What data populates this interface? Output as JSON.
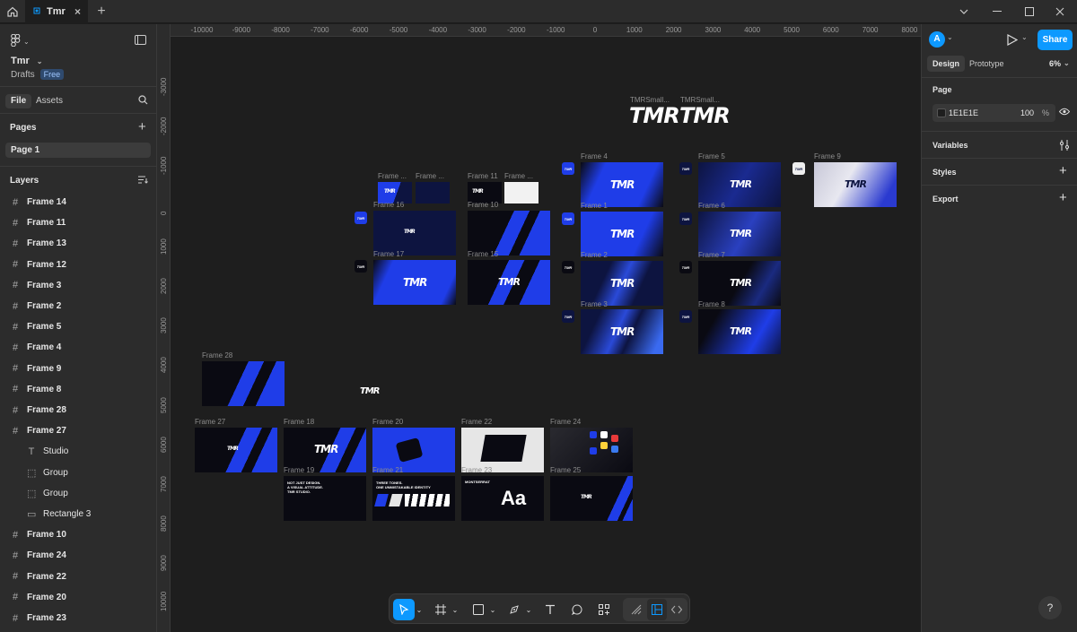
{
  "tabs": {
    "file_tab_label": "Tmr"
  },
  "left_panel": {
    "file_name": "Tmr",
    "location": "Drafts",
    "plan_badge": "Free",
    "file_tab": "File",
    "assets_tab": "Assets",
    "pages_title": "Pages",
    "pages": [
      "Page 1"
    ],
    "layers_title": "Layers",
    "layers": [
      {
        "label": "Frame 14",
        "type": "frame"
      },
      {
        "label": "Frame 11",
        "type": "frame"
      },
      {
        "label": "Frame 13",
        "type": "frame"
      },
      {
        "label": "Frame 12",
        "type": "frame"
      },
      {
        "label": "Frame 3",
        "type": "frame"
      },
      {
        "label": "Frame 2",
        "type": "frame"
      },
      {
        "label": "Frame 5",
        "type": "frame"
      },
      {
        "label": "Frame 4",
        "type": "frame"
      },
      {
        "label": "Frame 9",
        "type": "frame"
      },
      {
        "label": "Frame 8",
        "type": "frame"
      },
      {
        "label": "Frame 28",
        "type": "frame"
      },
      {
        "label": "Frame 27",
        "type": "frame"
      },
      {
        "label": "Studio",
        "type": "text"
      },
      {
        "label": "Group",
        "type": "group"
      },
      {
        "label": "Group",
        "type": "group"
      },
      {
        "label": "Rectangle 3",
        "type": "rect"
      },
      {
        "label": "Frame 10",
        "type": "frame"
      },
      {
        "label": "Frame 24",
        "type": "frame"
      },
      {
        "label": "Frame 22",
        "type": "frame"
      },
      {
        "label": "Frame 20",
        "type": "frame"
      },
      {
        "label": "Frame 23",
        "type": "frame"
      }
    ]
  },
  "rulers": {
    "x": [
      "-10000",
      "-9000",
      "-8000",
      "-7000",
      "-6000",
      "-5000",
      "-4000",
      "-3000",
      "-2000",
      "-1000",
      "0",
      "1000",
      "2000",
      "3000",
      "4000",
      "5000",
      "6000",
      "7000",
      "8000"
    ],
    "y": [
      "-3000",
      "-2000",
      "-1000",
      "0",
      "1000",
      "2000",
      "3000",
      "4000",
      "5000",
      "6000",
      "7000",
      "8000",
      "9000",
      "10000"
    ]
  },
  "canvas": {
    "component_labels": [
      "TMRSmall...",
      "TMRSmall..."
    ],
    "logo_text": "TMR",
    "frame_labels": {
      "f_small_a": "Frame ...",
      "f_small_b": "Frame ...",
      "f11": "Frame 11",
      "f_small_d": "Frame ...",
      "f4": "Frame 4",
      "f5": "Frame 5",
      "f9": "Frame 9",
      "f16": "Frame 16",
      "f10": "Frame 10",
      "f1": "Frame 1",
      "f6": "Frame 6",
      "f17": "Frame 17",
      "f15": "Frame 15",
      "f2": "Frame 2",
      "f7": "Frame 7",
      "f3": "Frame 3",
      "f8": "Frame 8",
      "f28": "Frame 28",
      "f27": "Frame 27",
      "f18": "Frame 18",
      "f20": "Frame 20",
      "f22": "Frame 22",
      "f24": "Frame 24",
      "f19": "Frame 19",
      "f21": "Frame 21",
      "f23": "Frame 23",
      "f25": "Frame 25"
    },
    "f19_text": [
      "NOT JUST DESIGN.",
      "A VISUAL ATTITUDE.",
      "TMR STUDIO."
    ],
    "f21_text": [
      "THREE TONES.",
      "ONE UNMISTAKABLE IDENTITY"
    ],
    "f23_text": "MONTSERRAT",
    "f23_glyph": "Aa"
  },
  "right_panel": {
    "avatar_letter": "A",
    "share_label": "Share",
    "design_tab": "Design",
    "prototype_tab": "Prototype",
    "zoom": "6%",
    "page_title": "Page",
    "page_color_hex": "1E1E1E",
    "page_opacity": "100",
    "percent": "%",
    "variables": "Variables",
    "styles": "Styles",
    "export": "Export"
  },
  "colors": {
    "accent": "#0d99ff",
    "brand_blue": "#1f3de8",
    "canvas_bg": "#1e1e1e",
    "panel_bg": "#2c2c2c"
  },
  "help_label": "?"
}
